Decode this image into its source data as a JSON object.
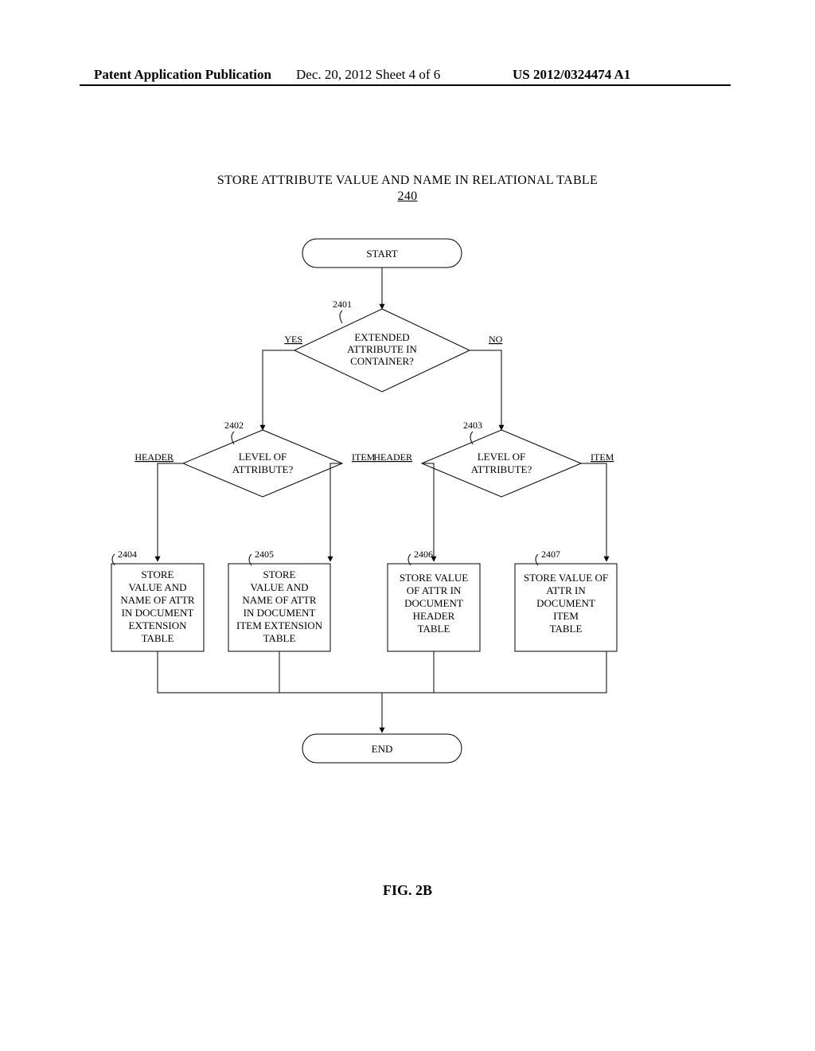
{
  "header": {
    "left": "Patent Application Publication",
    "center": "Dec. 20, 2012  Sheet 4 of 6",
    "right": "US 2012/0324474 A1"
  },
  "title": {
    "line": "STORE ATTRIBUTE VALUE AND NAME IN RELATIONAL TABLE",
    "ref": "240"
  },
  "nodes": {
    "start": "START",
    "end": "END",
    "d1": {
      "ref": "2401",
      "text": [
        "EXTENDED",
        "ATTRIBUTE IN",
        "CONTAINER?"
      ],
      "yes": "YES",
      "no": "NO"
    },
    "d2": {
      "ref": "2402",
      "text": [
        "LEVEL OF",
        "ATTRIBUTE?"
      ],
      "left": "HEADER",
      "right": "ITEM"
    },
    "d3": {
      "ref": "2403",
      "text": [
        "LEVEL OF",
        "ATTRIBUTE?"
      ],
      "left": "HEADER",
      "right": "ITEM"
    },
    "p4": {
      "ref": "2404",
      "text": [
        "STORE",
        "VALUE AND",
        "NAME OF ATTR",
        "IN DOCUMENT",
        "EXTENSION",
        "TABLE"
      ]
    },
    "p5": {
      "ref": "2405",
      "text": [
        "STORE",
        "VALUE AND",
        "NAME OF ATTR",
        "IN DOCUMENT",
        "ITEM EXTENSION",
        "TABLE"
      ]
    },
    "p6": {
      "ref": "2406",
      "text": [
        "STORE VALUE",
        "OF ATTR IN",
        "DOCUMENT",
        "HEADER",
        "TABLE"
      ]
    },
    "p7": {
      "ref": "2407",
      "text": [
        "STORE VALUE OF",
        "ATTR IN",
        "DOCUMENT",
        "ITEM",
        "TABLE"
      ]
    }
  },
  "figcaption": "FIG. 2B"
}
